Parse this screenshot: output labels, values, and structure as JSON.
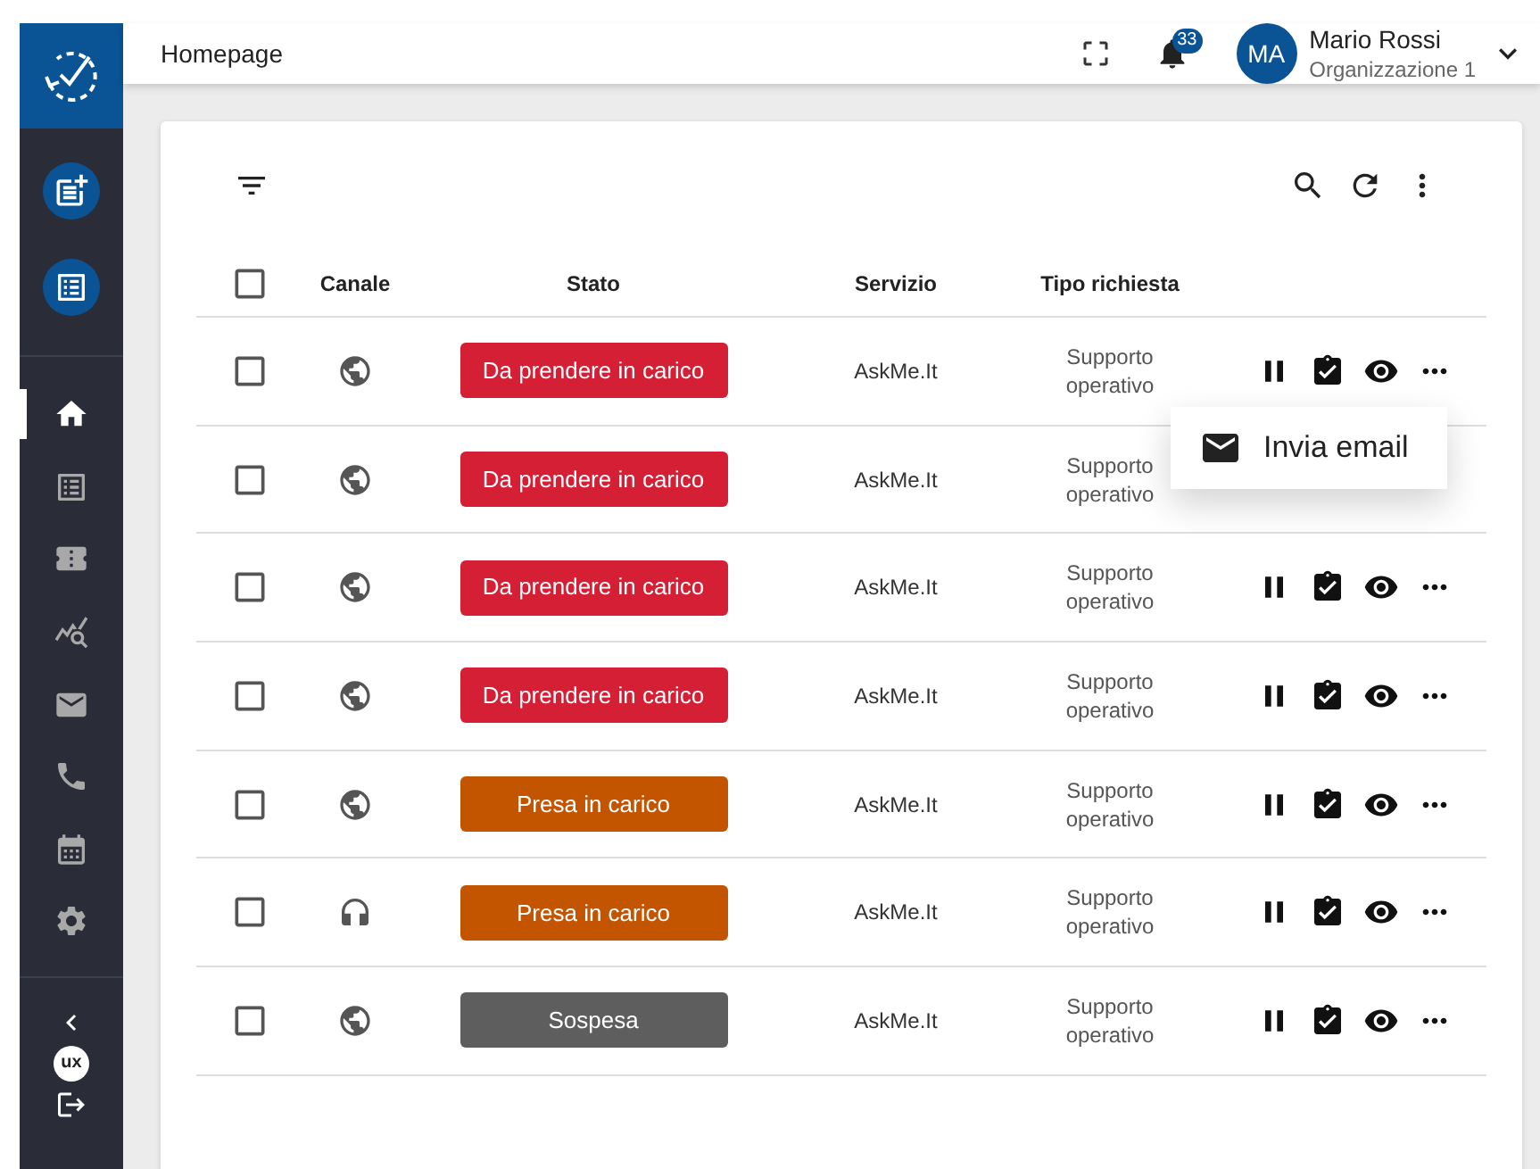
{
  "header": {
    "title": "Homepage",
    "notifications": "33",
    "user": {
      "initials": "MA",
      "name": "Mario Rossi",
      "organization": "Organizzazione 1"
    }
  },
  "sidebar": {
    "logo_text": "ux",
    "nav": [
      {
        "selected": true
      },
      {
        "selected": false
      },
      {
        "selected": false
      },
      {
        "selected": false
      },
      {
        "selected": false
      },
      {
        "selected": false
      },
      {
        "selected": false
      },
      {
        "selected": false
      }
    ]
  },
  "table": {
    "columns": [
      "Canale",
      "Stato",
      "Servizio",
      "Tipo richiesta"
    ],
    "all_checked": false,
    "rows": [
      {
        "checked": false,
        "channel": {
          "kind": "web"
        },
        "status": {
          "label": "Da prendere in carico",
          "kind": "new"
        },
        "service": "AskMe.It",
        "request_type": "Supporto operativo",
        "menu": {
          "items": [
            {
              "label": "Invia email"
            }
          ]
        }
      },
      {
        "checked": false,
        "channel": {
          "kind": "web"
        },
        "status": {
          "label": "Da prendere in carico",
          "kind": "new"
        },
        "service": "AskMe.It",
        "request_type": "Supporto operativo"
      },
      {
        "checked": false,
        "channel": {
          "kind": "web"
        },
        "status": {
          "label": "Da prendere in carico",
          "kind": "new"
        },
        "service": "AskMe.It",
        "request_type": "Supporto operativo"
      },
      {
        "checked": false,
        "channel": {
          "kind": "web"
        },
        "status": {
          "label": "Da prendere in carico",
          "kind": "new"
        },
        "service": "AskMe.It",
        "request_type": "Supporto operativo"
      },
      {
        "checked": false,
        "channel": {
          "kind": "web"
        },
        "status": {
          "label": "Presa in carico",
          "kind": "taken"
        },
        "service": "AskMe.It",
        "request_type": "Supporto operativo"
      },
      {
        "checked": false,
        "channel": {
          "kind": "phone"
        },
        "status": {
          "label": "Presa in carico",
          "kind": "taken"
        },
        "service": "AskMe.It",
        "request_type": "Supporto operativo"
      },
      {
        "checked": false,
        "channel": {
          "kind": "web"
        },
        "status": {
          "label": "Sospesa",
          "kind": "suspended"
        },
        "service": "AskMe.It",
        "request_type": "Supporto operativo"
      }
    ]
  }
}
